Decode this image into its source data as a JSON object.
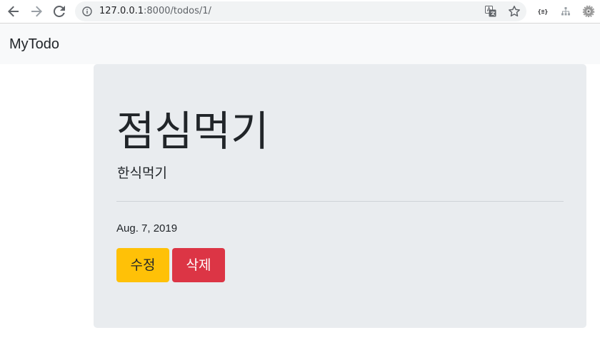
{
  "browser": {
    "url_host": "127.0.0.1",
    "url_rest": ":8000/todos/1/",
    "extension_json_label": "{≡}"
  },
  "navbar": {
    "brand": "MyTodo"
  },
  "todo": {
    "title": "점심먹기",
    "description": "한식먹기",
    "date": "Aug. 7, 2019",
    "edit_label": "수정",
    "delete_label": "삭제"
  },
  "colors": {
    "navbar_bg": "#f8f9fa",
    "jumbotron_bg": "#e9ecef",
    "edit_button": "#ffc107",
    "delete_button": "#dc3545"
  },
  "icons": {
    "back": "arrow-left-icon",
    "forward": "arrow-right-icon",
    "reload": "reload-icon",
    "info": "info-icon",
    "translate": "translate-icon",
    "bookmark": "star-icon",
    "ext_json": "json-viewer-icon",
    "ext_tree": "tree-icon",
    "ext_gear": "gear-icon"
  }
}
